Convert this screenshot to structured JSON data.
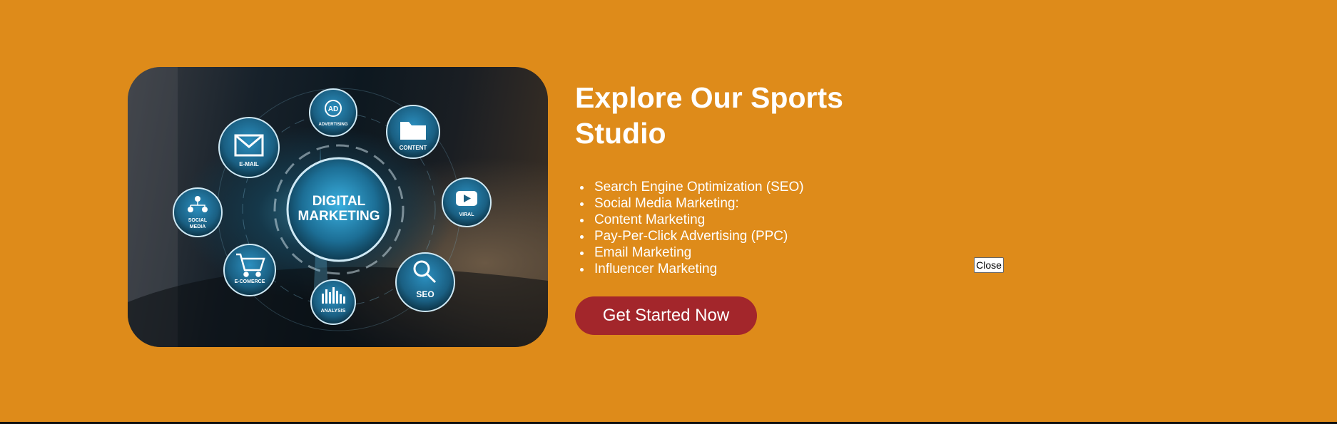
{
  "hero": {
    "center_line1": "DIGITAL",
    "center_line2": "MARKETING",
    "nodes": {
      "ad_symbol": "AD",
      "advertising": "ADVERTISING",
      "content": "CONTENT",
      "email": "E-MAIL",
      "social_line1": "SOCIAL",
      "social_line2": "MEDIA",
      "viral": "VIRAL",
      "ecommerce": "E-COMERCE",
      "analysis": "ANALYSIS",
      "seo": "SEO"
    }
  },
  "title": "Explore Our Sports Studio",
  "services": [
    "Search Engine Optimization (SEO)",
    "Social Media Marketing:",
    "Content Marketing",
    "Pay-Per-Click Advertising (PPC)",
    "Email Marketing",
    "Influencer Marketing"
  ],
  "cta_label": "Get Started Now",
  "close_label": "Close",
  "colors": {
    "background": "#de8b1a",
    "cta": "#a3262b",
    "node": "#1d6f96"
  },
  "icons": [
    "envelope-icon",
    "folder-icon",
    "play-icon",
    "network-icon",
    "cart-icon",
    "bar-chart-icon",
    "magnifier-icon"
  ]
}
